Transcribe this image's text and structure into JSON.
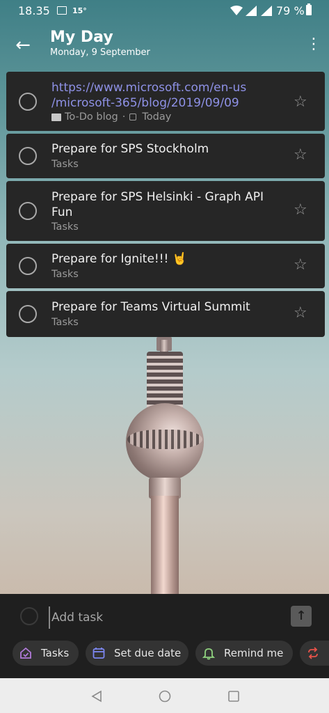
{
  "status": {
    "time": "18.35",
    "temperature": "15°",
    "battery": "79 %"
  },
  "header": {
    "title": "My Day",
    "subtitle": "Monday, 9 September",
    "back_icon": "arrow-left-icon",
    "menu_icon": "more-vertical-icon"
  },
  "tasks": [
    {
      "title": "https://www.microsoft.com/en-us/microsoft-365/blog/2019/09/09",
      "title_line1": "https://www.microsoft.com/en-us",
      "title_line2": "/microsoft-365/blog/2019/09/09",
      "list": "To-Do blog",
      "separator": "·",
      "due": "Today",
      "is_link": true
    },
    {
      "title": "Prepare for SPS Stockholm",
      "list": "Tasks"
    },
    {
      "title": "Prepare for SPS Helsinki - Graph API Fun",
      "title_line1": "Prepare for SPS Helsinki - Graph API",
      "title_line2": "Fun",
      "list": "Tasks"
    },
    {
      "title": "Prepare for Ignite!!! 🤘",
      "list": "Tasks"
    },
    {
      "title": "Prepare for Teams Virtual Summit",
      "list": "Tasks"
    }
  ],
  "add_task": {
    "placeholder": "Add task",
    "send_icon": "arrow-up-icon"
  },
  "chips": [
    {
      "label": "Tasks",
      "icon": "home-list-icon",
      "color": "#b07ad8"
    },
    {
      "label": "Set due date",
      "icon": "calendar-icon",
      "color": "#7c86f0"
    },
    {
      "label": "Remind me",
      "icon": "bell-icon",
      "color": "#8fd17f"
    },
    {
      "label": "",
      "icon": "repeat-icon",
      "color": "#e8534a"
    }
  ],
  "nav": {
    "back_icon": "triangle-back-icon",
    "home_icon": "circle-home-icon",
    "recents_icon": "square-recents-icon"
  }
}
